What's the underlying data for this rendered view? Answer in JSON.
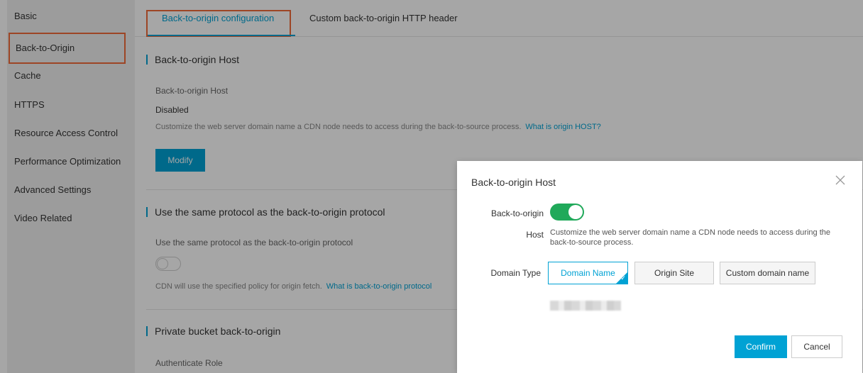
{
  "sidebar": {
    "items": [
      {
        "label": "Basic"
      },
      {
        "label": "Back-to-Origin"
      },
      {
        "label": "Cache"
      },
      {
        "label": "HTTPS"
      },
      {
        "label": "Resource Access Control"
      },
      {
        "label": "Performance Optimization"
      },
      {
        "label": "Advanced Settings"
      },
      {
        "label": "Video Related"
      }
    ],
    "active_index": 1
  },
  "tabs": [
    {
      "label": "Back-to-origin configuration"
    },
    {
      "label": "Custom back-to-origin HTTP header"
    }
  ],
  "sections": {
    "host": {
      "title": "Back-to-origin Host",
      "field_label": "Back-to-origin Host",
      "value": "Disabled",
      "description": "Customize the web server domain name a CDN node needs to access during the back-to-source process.",
      "link": "What is origin HOST?",
      "modify_label": "Modify"
    },
    "protocol": {
      "title": "Use the same protocol as the back-to-origin protocol",
      "field_label": "Use the same protocol as the back-to-origin protocol",
      "enabled": false,
      "description": "CDN will use the specified policy for origin fetch.",
      "link": "What is back-to-origin protocol"
    },
    "private_bucket": {
      "title": "Private bucket back-to-origin",
      "field_label": "Authenticate Role"
    }
  },
  "modal": {
    "title": "Back-to-origin Host",
    "toggle_label_line1": "Back-to-origin",
    "toggle_label_line2": "Host",
    "toggle_on": true,
    "description": "Customize the web server domain name a CDN node needs to access during the back-to-source process.",
    "domain_type_label": "Domain Type",
    "domain_type_options": [
      "Domain Name",
      "Origin Site",
      "Custom domain name"
    ],
    "domain_type_selected": "Domain Name",
    "confirm_label": "Confirm",
    "cancel_label": "Cancel"
  },
  "colors": {
    "accent": "#00a2d4",
    "highlight": "#f26b3a",
    "toggle_on": "#20a95a"
  }
}
